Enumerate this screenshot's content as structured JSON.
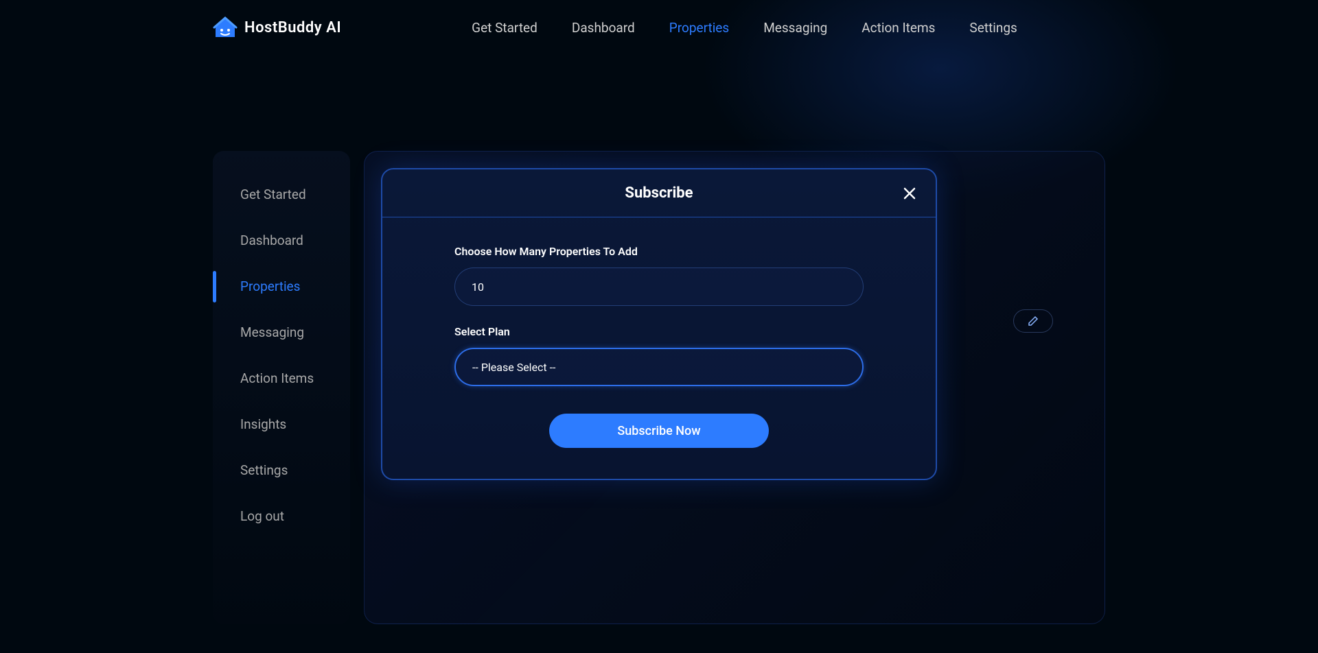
{
  "brand": "HostBuddy AI",
  "topNav": {
    "items": [
      {
        "label": "Get Started",
        "active": false
      },
      {
        "label": "Dashboard",
        "active": false
      },
      {
        "label": "Properties",
        "active": true
      },
      {
        "label": "Messaging",
        "active": false
      },
      {
        "label": "Action Items",
        "active": false
      },
      {
        "label": "Settings",
        "active": false
      }
    ]
  },
  "sidebar": {
    "items": [
      {
        "label": "Get Started",
        "active": false
      },
      {
        "label": "Dashboard",
        "active": false
      },
      {
        "label": "Properties",
        "active": true
      },
      {
        "label": "Messaging",
        "active": false
      },
      {
        "label": "Action Items",
        "active": false
      },
      {
        "label": "Insights",
        "active": false
      },
      {
        "label": "Settings",
        "active": false
      },
      {
        "label": "Log out",
        "active": false
      }
    ]
  },
  "modal": {
    "title": "Subscribe",
    "propertiesLabel": "Choose How Many Properties To Add",
    "propertiesValue": "10",
    "planLabel": "Select Plan",
    "planPlaceholder": "-- Please Select --",
    "submitLabel": "Subscribe Now"
  }
}
